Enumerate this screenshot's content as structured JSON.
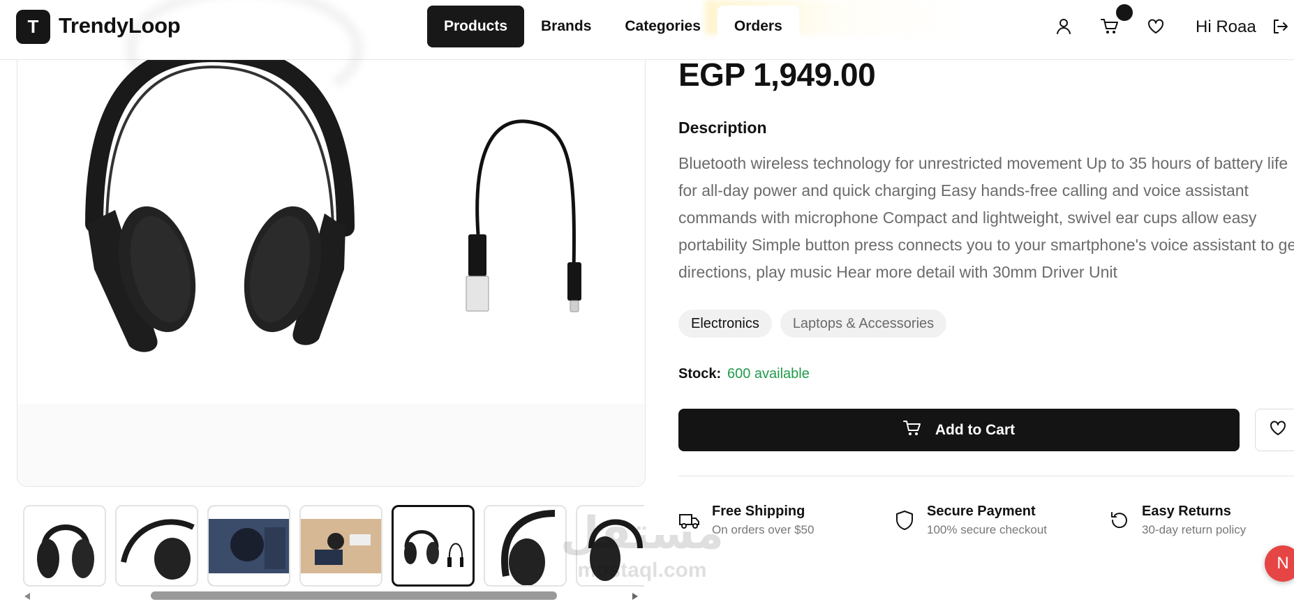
{
  "header": {
    "logo_letter": "T",
    "brand_name": "TrendyLoop",
    "nav": [
      {
        "label": "Products",
        "active": true
      },
      {
        "label": "Brands",
        "active": false
      },
      {
        "label": "Categories",
        "active": false
      },
      {
        "label": "Orders",
        "active": false
      }
    ],
    "icons": [
      "user-icon",
      "cart-icon",
      "heart-icon",
      "logout-icon"
    ],
    "greeting": "Hi Roaa"
  },
  "product": {
    "price": "EGP 1,949.00",
    "description_title": "Description",
    "description": "Bluetooth wireless technology for unrestricted movement Up to 35 hours of battery life for all-day power and quick charging Easy hands-free calling and voice assistant commands with microphone Compact and lightweight, swivel ear cups allow easy portability Simple button press connects you to your smartphone's voice assistant to get directions, play music Hear more detail with 30mm Driver Unit",
    "tags": [
      "Electronics",
      "Laptops & Accessories"
    ],
    "stock_label": "Stock:",
    "stock_value": "600 available",
    "add_to_cart_label": "Add to Cart",
    "selected_thumbnail": 5
  },
  "features": [
    {
      "title": "Free Shipping",
      "subtitle": "On orders over $50",
      "icon": "truck-icon"
    },
    {
      "title": "Secure Payment",
      "subtitle": "100% secure checkout",
      "icon": "shield-icon"
    },
    {
      "title": "Easy Returns",
      "subtitle": "30-day return policy",
      "icon": "refresh-icon"
    }
  ],
  "watermark": {
    "arabic": "مستقل",
    "latin": "mostaql.com"
  },
  "fab_label": "N",
  "colors": {
    "primary": "#141414",
    "stock_green": "#1f9b4b",
    "fab_red": "#e64545"
  }
}
